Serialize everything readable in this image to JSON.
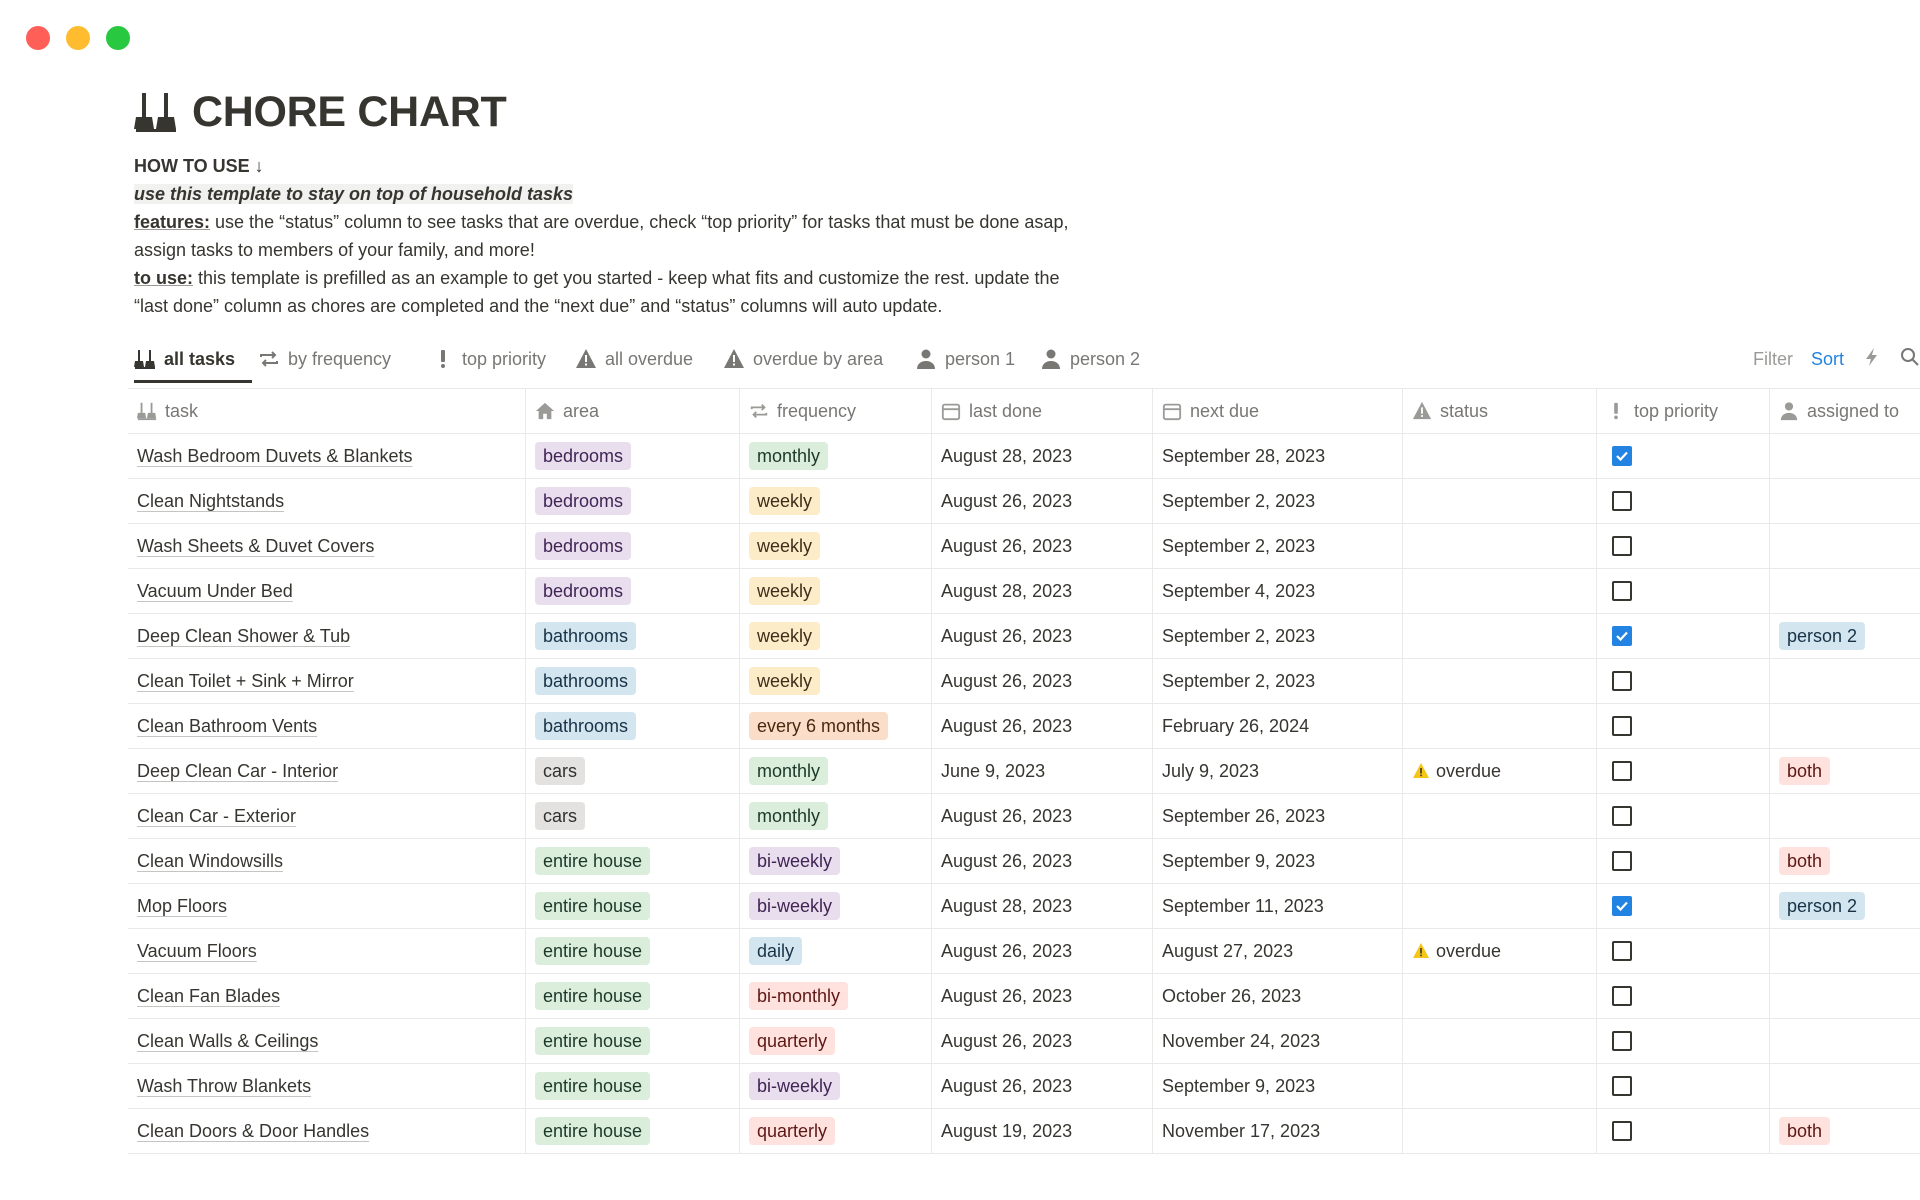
{
  "window": {
    "controls": [
      "close",
      "minimize",
      "zoom"
    ]
  },
  "page": {
    "title": "CHORE CHART",
    "icon": "broom-icon",
    "how_to_use": "HOW TO USE ↓",
    "tagline": "use this template to stay on top of household tasks",
    "features_label": "features:",
    "features_text": " use the “status” column to see tasks that are overdue, check “top priority” for tasks that must be done asap,",
    "features_text2": "assign tasks to members of your family, and more!",
    "touse_label": "to use:",
    "touse_text": " this template is prefilled as an example to get you started - keep what fits and customize the rest. update the",
    "touse_text2": "“last done” column as chores are completed and the “next due” and “status” columns will auto update."
  },
  "tabs": [
    {
      "label": "all tasks",
      "icon": "broom-icon",
      "active": true
    },
    {
      "label": "by frequency",
      "icon": "repeat-icon"
    },
    {
      "label": "top priority",
      "icon": "exclamation-icon"
    },
    {
      "label": "all overdue",
      "icon": "warning-icon"
    },
    {
      "label": "overdue by area",
      "icon": "warning-icon"
    },
    {
      "label": "person 1",
      "icon": "person-icon"
    },
    {
      "label": "person 2",
      "icon": "person-icon"
    }
  ],
  "toolbar": {
    "filter": "Filter",
    "sort": "Sort",
    "automation_icon": "lightning-icon",
    "search_icon": "search-icon"
  },
  "columns": [
    {
      "label": "task",
      "icon": "broom-icon"
    },
    {
      "label": "area",
      "icon": "home-icon"
    },
    {
      "label": "frequency",
      "icon": "repeat-icon"
    },
    {
      "label": "last done",
      "icon": "calendar-icon"
    },
    {
      "label": "next due",
      "icon": "calendar-icon"
    },
    {
      "label": "status",
      "icon": "warning-icon"
    },
    {
      "label": "top priority",
      "icon": "exclamation-icon"
    },
    {
      "label": "assigned to",
      "icon": "person-icon"
    }
  ],
  "colors": {
    "bedrooms": [
      "#e8deee",
      "#412454"
    ],
    "bathrooms": [
      "#d3e5ef",
      "#183347"
    ],
    "cars": [
      "#e3e2e0",
      "#32302c"
    ],
    "entire house": [
      "#dbeddb",
      "#1c3829"
    ],
    "monthly": [
      "#dbeddb",
      "#1c3829"
    ],
    "weekly": [
      "#fdecc8",
      "#402c1b"
    ],
    "every 6 months": [
      "#fadec9",
      "#49290e"
    ],
    "bi-weekly": [
      "#e8deee",
      "#412454"
    ],
    "daily": [
      "#d3e5ef",
      "#183347"
    ],
    "bi-monthly": [
      "#ffe2dd",
      "#5d1715"
    ],
    "quarterly": [
      "#ffe2dd",
      "#5d1715"
    ],
    "person 2": [
      "#d3e5ef",
      "#183347"
    ],
    "both": [
      "#ffe2dd",
      "#5d1715"
    ],
    "checkbox_on": "#2383e2",
    "accent_sort": "#2383e2"
  },
  "rows": [
    {
      "task": "Wash Bedroom Duvets & Blankets",
      "area": "bedrooms",
      "frequency": "monthly",
      "last_done": "August 28, 2023",
      "next_due": "September 28, 2023",
      "status": "",
      "top_priority": true,
      "assigned_to": ""
    },
    {
      "task": "Clean Nightstands",
      "area": "bedrooms",
      "frequency": "weekly",
      "last_done": "August 26, 2023",
      "next_due": "September 2, 2023",
      "status": "",
      "top_priority": false,
      "assigned_to": ""
    },
    {
      "task": "Wash Sheets & Duvet Covers",
      "area": "bedrooms",
      "frequency": "weekly",
      "last_done": "August 26, 2023",
      "next_due": "September 2, 2023",
      "status": "",
      "top_priority": false,
      "assigned_to": ""
    },
    {
      "task": "Vacuum Under Bed",
      "area": "bedrooms",
      "frequency": "weekly",
      "last_done": "August 28, 2023",
      "next_due": "September 4, 2023",
      "status": "",
      "top_priority": false,
      "assigned_to": ""
    },
    {
      "task": "Deep Clean Shower & Tub",
      "area": "bathrooms",
      "frequency": "weekly",
      "last_done": "August 26, 2023",
      "next_due": "September 2, 2023",
      "status": "",
      "top_priority": true,
      "assigned_to": "person 2"
    },
    {
      "task": "Clean Toilet + Sink + Mirror",
      "area": "bathrooms",
      "frequency": "weekly",
      "last_done": "August 26, 2023",
      "next_due": "September 2, 2023",
      "status": "",
      "top_priority": false,
      "assigned_to": ""
    },
    {
      "task": "Clean Bathroom Vents",
      "area": "bathrooms",
      "frequency": "every 6 months",
      "last_done": "August 26, 2023",
      "next_due": "February 26, 2024",
      "status": "",
      "top_priority": false,
      "assigned_to": ""
    },
    {
      "task": "Deep Clean Car - Interior",
      "area": "cars",
      "frequency": "monthly",
      "last_done": "June 9, 2023",
      "next_due": "July 9, 2023",
      "status": "overdue",
      "top_priority": false,
      "assigned_to": "both"
    },
    {
      "task": "Clean Car - Exterior",
      "area": "cars",
      "frequency": "monthly",
      "last_done": "August 26, 2023",
      "next_due": "September 26, 2023",
      "status": "",
      "top_priority": false,
      "assigned_to": ""
    },
    {
      "task": "Clean Windowsills",
      "area": "entire house",
      "frequency": "bi-weekly",
      "last_done": "August 26, 2023",
      "next_due": "September 9, 2023",
      "status": "",
      "top_priority": false,
      "assigned_to": "both"
    },
    {
      "task": "Mop Floors",
      "area": "entire house",
      "frequency": "bi-weekly",
      "last_done": "August 28, 2023",
      "next_due": "September 11, 2023",
      "status": "",
      "top_priority": true,
      "assigned_to": "person 2"
    },
    {
      "task": "Vacuum Floors",
      "area": "entire house",
      "frequency": "daily",
      "last_done": "August 26, 2023",
      "next_due": "August 27, 2023",
      "status": "overdue",
      "top_priority": false,
      "assigned_to": ""
    },
    {
      "task": "Clean Fan Blades",
      "area": "entire house",
      "frequency": "bi-monthly",
      "last_done": "August 26, 2023",
      "next_due": "October 26, 2023",
      "status": "",
      "top_priority": false,
      "assigned_to": ""
    },
    {
      "task": "Clean Walls & Ceilings",
      "area": "entire house",
      "frequency": "quarterly",
      "last_done": "August 26, 2023",
      "next_due": "November 24, 2023",
      "status": "",
      "top_priority": false,
      "assigned_to": ""
    },
    {
      "task": "Wash Throw Blankets",
      "area": "entire house",
      "frequency": "bi-weekly",
      "last_done": "August 26, 2023",
      "next_due": "September 9, 2023",
      "status": "",
      "top_priority": false,
      "assigned_to": ""
    },
    {
      "task": "Clean Doors & Door Handles",
      "area": "entire house",
      "frequency": "quarterly",
      "last_done": "August 19, 2023",
      "next_due": "November 17, 2023",
      "status": "",
      "top_priority": false,
      "assigned_to": "both"
    }
  ]
}
